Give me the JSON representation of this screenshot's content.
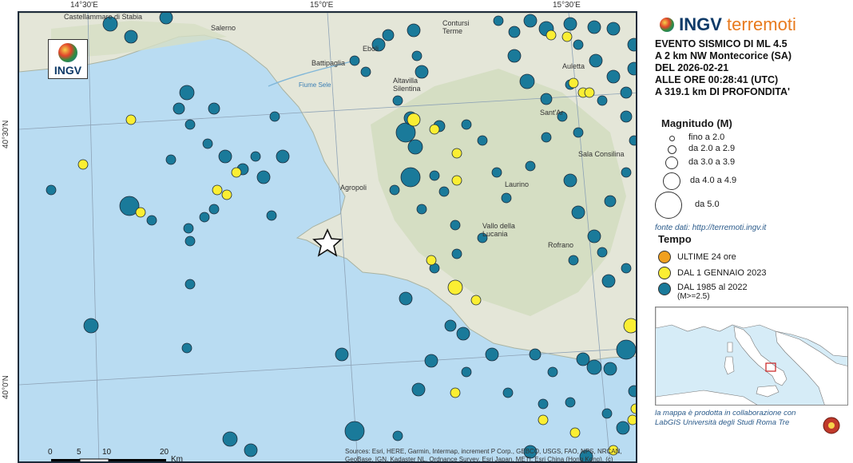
{
  "map": {
    "lon_labels": [
      "14°30'E",
      "15°0'E",
      "15°30'E"
    ],
    "lat_labels": [
      "40°30'N",
      "40°0'N"
    ],
    "place_labels": [
      "Castellammare di Stabia",
      "Salerno",
      "Eboli",
      "Battipaglia",
      "Altavilla Silentina",
      "Contursi Terme",
      "Auletta",
      "Sant'Ar",
      "Laurino",
      "Agropoli",
      "Vallo della Lucania",
      "Rofrano",
      "Sala Consilina",
      "Fiume Sele"
    ],
    "logo_text": "INGV",
    "scale": {
      "ticks": [
        "0",
        "5",
        "10",
        "20"
      ],
      "unit": "Km"
    },
    "attribution": "Sources: Esri, HERE, Garmin, Intermap, increment P Corp., GEBCO, USGS, FAO, NPS, NRCAN, GeoBase, IGN, Kadaster NL, Ordnance Survey, Esri Japan, METI, Esri China (Hong Kong), (c) OpenStreetMap contributors, and the GIS User Community"
  },
  "panel": {
    "brand_main": "INGV",
    "brand_sub": "terremoti",
    "event_lines": [
      "EVENTO SISMICO DI ML 4.5",
      "A 2 km NW Montecorice (SA)",
      "DEL 2026-02-21",
      "ALLE ORE 00:28:41 (UTC)",
      "A 319.1 km DI PROFONDITA'"
    ],
    "magnitude_title": "Magnitudo (M)",
    "magnitude_classes": [
      "fino a 2.0",
      "da 2.0 a 2.9",
      "da 3.0 a 3.9",
      "da 4.0 a 4.9",
      "da 5.0"
    ],
    "source_text": "fonte dati: http://terremoti.ingv.it",
    "time_title": "Tempo",
    "time_classes": [
      {
        "label": "ULTIME 24 ore",
        "color": "#f0a020"
      },
      {
        "label": "DAL 1 GENNAIO 2023",
        "color": "#fbee33"
      },
      {
        "label": "DAL 1985 al 2022",
        "label2": "(M>=2.5)",
        "color": "#1a7a9a"
      }
    ],
    "credit_line1": "la mappa è prodotta in collaborazione con",
    "credit_line2": "LabGIS Università degli Studi Roma Tre"
  },
  "colors": {
    "sea": "#b9dcf2",
    "land": "#e4e6d8",
    "teal": "#1a7a9a",
    "yellow": "#fbee33",
    "orange": "#f0a020"
  }
}
